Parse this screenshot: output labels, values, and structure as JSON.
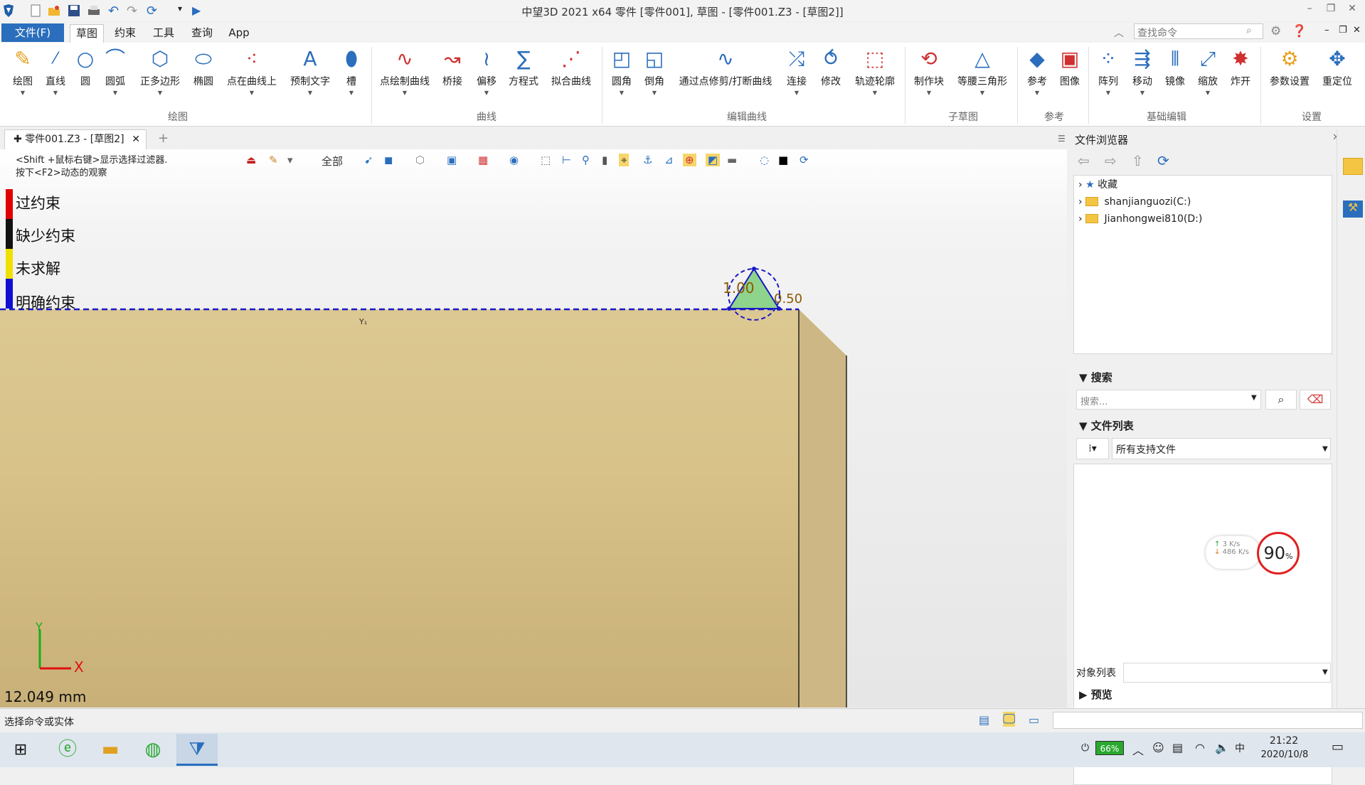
{
  "window": {
    "title": "中望3D 2021 x64        零件 [零件001], 草图 - [零件001.Z3 - [草图2]]"
  },
  "menu": {
    "file": "文件(F)",
    "tabs": [
      "草图",
      "约束",
      "工具",
      "查询",
      "App"
    ],
    "search_placeholder": "查找命令"
  },
  "ribbon": {
    "buttons": [
      {
        "label": "绘图",
        "icon": "pencil-draw-icon"
      },
      {
        "label": "直线",
        "icon": "line-icon"
      },
      {
        "label": "圆",
        "icon": "circle-icon"
      },
      {
        "label": "圆弧",
        "icon": "arc-icon"
      },
      {
        "label": "正多边形",
        "icon": "polygon-icon"
      },
      {
        "label": "椭圆",
        "icon": "ellipse-icon"
      },
      {
        "label": "点在曲线上",
        "icon": "point-on-curve-icon"
      },
      {
        "label": "预制文字",
        "icon": "text-icon"
      },
      {
        "label": "槽",
        "icon": "slot-icon"
      },
      {
        "label": "点绘制曲线",
        "icon": "spline-icon"
      },
      {
        "label": "桥接",
        "icon": "bridge-icon"
      },
      {
        "label": "偏移",
        "icon": "offset-icon"
      },
      {
        "label": "方程式",
        "icon": "equation-icon"
      },
      {
        "label": "拟合曲线",
        "icon": "fit-curve-icon"
      },
      {
        "label": "圆角",
        "icon": "fillet-icon"
      },
      {
        "label": "倒角",
        "icon": "chamfer-icon"
      },
      {
        "label": "通过点修剪/打断曲线",
        "icon": "trim-icon"
      },
      {
        "label": "连接",
        "icon": "join-icon"
      },
      {
        "label": "修改",
        "icon": "modify-icon"
      },
      {
        "label": "轨迹轮廓",
        "icon": "trace-icon"
      },
      {
        "label": "制作块",
        "icon": "block-icon"
      },
      {
        "label": "等腰三角形",
        "icon": "triangle-icon"
      },
      {
        "label": "参考",
        "icon": "reference-icon"
      },
      {
        "label": "图像",
        "icon": "image-icon"
      },
      {
        "label": "阵列",
        "icon": "pattern-icon"
      },
      {
        "label": "移动",
        "icon": "move-icon"
      },
      {
        "label": "镜像",
        "icon": "mirror-icon"
      },
      {
        "label": "缩放",
        "icon": "scale-icon"
      },
      {
        "label": "炸开",
        "icon": "explode-icon"
      },
      {
        "label": "参数设置",
        "icon": "settings-icon"
      },
      {
        "label": "重定位",
        "icon": "relocate-icon"
      }
    ],
    "groups": [
      "绘图",
      "曲线",
      "编辑曲线",
      "子草图",
      "参考",
      "基础编辑",
      "设置"
    ]
  },
  "doc_tab": {
    "label": "零件001.Z3 - [草图2]"
  },
  "viewport": {
    "hint1": "<Shift +鼠标右键>显示选择过滤器.",
    "hint2": "按下<F2>动态的观察",
    "filter_label": "全部",
    "legend": [
      {
        "label": "过约束",
        "color": "#e00000"
      },
      {
        "label": "缺少约束",
        "color": "#111111"
      },
      {
        "label": "未求解",
        "color": "#f0e000"
      },
      {
        "label": "明确约束",
        "color": "#1010d0"
      }
    ],
    "dim_a": "1.00",
    "dim_b": "0.50",
    "axis_x": "X",
    "axis_y": "Y",
    "measure": "12.049 mm"
  },
  "file_browser": {
    "title": "文件浏览器",
    "tree": [
      {
        "label": "收藏",
        "icon": "star-icon"
      },
      {
        "label": "shanjianguozi(C:)",
        "icon": "folder-icon"
      },
      {
        "label": "Jianhongwei810(D:)",
        "icon": "folder-icon"
      }
    ],
    "search_head": "搜索",
    "search_placeholder": "搜索...",
    "filelist_head": "文件列表",
    "file_filter": "所有支持文件",
    "object_list_label": "对象列表",
    "preview_head": "预览"
  },
  "net_widget": {
    "up": "3  K/s",
    "down": "486 K/s",
    "percent": "90"
  },
  "status": {
    "text": "选择命令或实体"
  },
  "taskbar": {
    "battery": "66%",
    "time": "21:22",
    "date": "2020/10/8"
  }
}
